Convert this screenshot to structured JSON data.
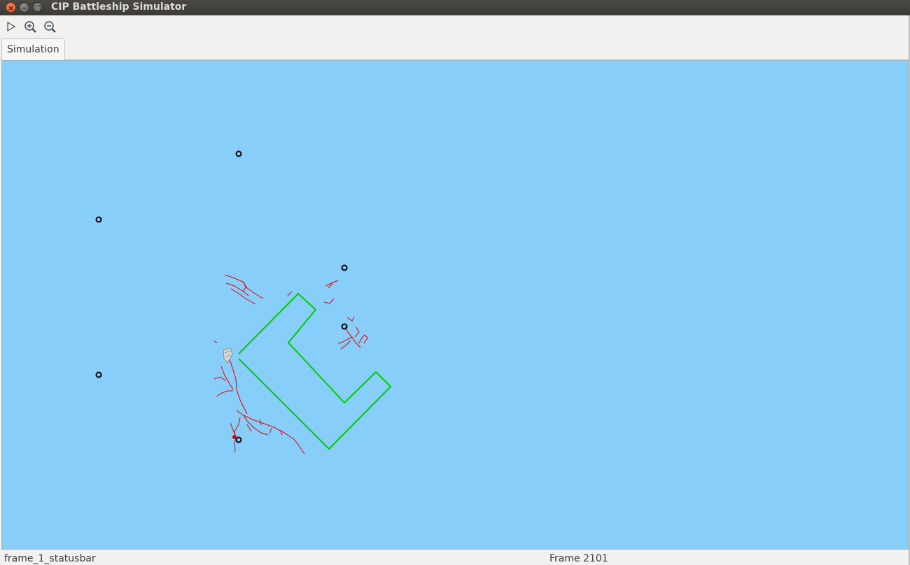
{
  "window": {
    "title": "CIP Battleship Simulator"
  },
  "window_buttons": {
    "close": "×",
    "minimize": "–",
    "maximize": "□"
  },
  "toolbar": {
    "play_icon": "play-icon",
    "zoom_in_icon": "zoom-in-icon",
    "zoom_out_icon": "zoom-out-icon"
  },
  "tabs": [
    {
      "label": "Simulation"
    }
  ],
  "colors": {
    "sea": "#87cefa",
    "path": "#00cc00",
    "trail": "#e00000",
    "buoy": "#000000"
  },
  "statusbar": {
    "left": "frame_1_statusbar",
    "right": "Frame 2101"
  }
}
